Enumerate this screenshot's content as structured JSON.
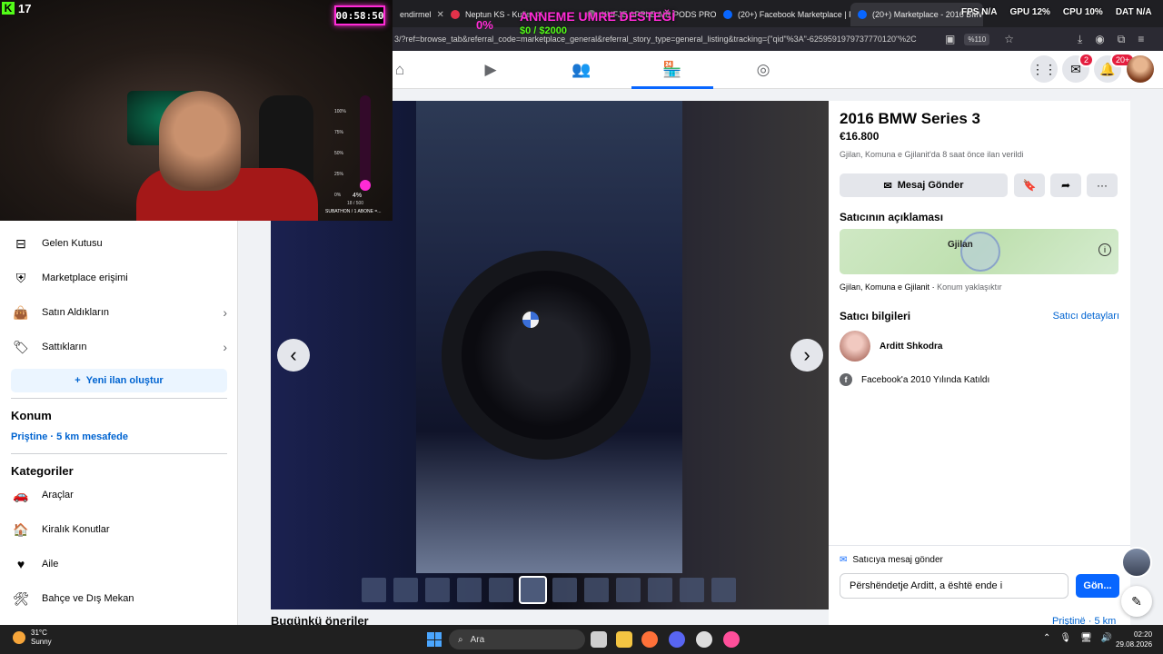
{
  "browser": {
    "tabs": [
      {
        "label": "endirmel",
        "color": "#888888"
      },
      {
        "label": "Neptun KS - Kufje",
        "color": "#e2324a"
      },
      {
        "label": "KUFJE APPLE AIR PODS PRO 2 V",
        "color": "#888888"
      },
      {
        "label": "(20+) Facebook Marketplace | F",
        "color": "#0866ff"
      },
      {
        "label": "(20+) Marketplace - 2016 BMW S",
        "color": "#0866ff",
        "active": true
      }
    ],
    "url": "3/?ref=browse_tab&referral_code=marketplace_general&referral_story_type=general_listing&tracking={\"qid\"%3A\"-6259591979737770120\"%2C",
    "zoom": "%110"
  },
  "nav": {
    "messenger_badge": "2",
    "notif_badge": "20+"
  },
  "sidebar": {
    "items": [
      {
        "label": "Gelen Kutusu",
        "icon": "inbox"
      },
      {
        "label": "Marketplace erişimi",
        "icon": "shield"
      },
      {
        "label": "Satın Aldıkların",
        "icon": "bag"
      },
      {
        "label": "Sattıkların",
        "icon": "tag"
      }
    ],
    "new_listing": "Yeni ilan oluştur",
    "location_title": "Konum",
    "location_value": "Priştine · 5 km mesafede",
    "categories_title": "Kategoriler",
    "categories": [
      {
        "label": "Araçlar",
        "icon": "car"
      },
      {
        "label": "Kiralık Konutlar",
        "icon": "house"
      },
      {
        "label": "Aile",
        "icon": "heart"
      },
      {
        "label": "Bahçe ve Dış Mekan",
        "icon": "tool"
      }
    ]
  },
  "listing": {
    "title": "2016 BMW Series 3",
    "price": "€16.800",
    "posted": "Gjilan, Komuna e Gjilanit'da 8 saat önce ilan verildi",
    "message_button": "Mesaj Gönder",
    "description_title": "Satıcının açıklaması",
    "map_label": "Gjilan",
    "location": "Gjilan, Komuna e Gjilanit",
    "location_note": "Konum yaklaşıktır",
    "seller_title": "Satıcı bilgileri",
    "seller_details_link": "Satıcı detayları",
    "seller_name": "Arditt Shkodra",
    "joined": "Facebook'a 2010 Yılında Katıldı",
    "message_box_title": "Satıcıya mesaj gönder",
    "message_draft": "Përshëndetje Arditt, a është ende i",
    "send_label": "Gön..."
  },
  "suggestions": {
    "title": "Bugünkü öneriler",
    "location": "Priştinë · 5 km"
  },
  "stream": {
    "kick_viewers": "17",
    "timer": "00:58:50",
    "gauge_ticks": [
      "100%",
      "75%",
      "50%",
      "25%",
      "0%"
    ],
    "gauge_percent": "4%",
    "gauge_fraction": 0.04,
    "gauge_count": "18 / 500",
    "subathon": "SUBATHON / 1 ABONE =...",
    "donation_title": "ANNEME UMRE DESTEĞİ",
    "donation_pct": "0%",
    "donation_amount": "$0 / $2000",
    "stats": [
      "FPS N/A",
      "GPU 12%",
      "CPU 10%",
      "DAT N/A"
    ]
  },
  "taskbar": {
    "temp": "31°C",
    "weather": "Sunny",
    "search_placeholder": "Ara",
    "time": "02:20",
    "date": "29.08.2026"
  }
}
